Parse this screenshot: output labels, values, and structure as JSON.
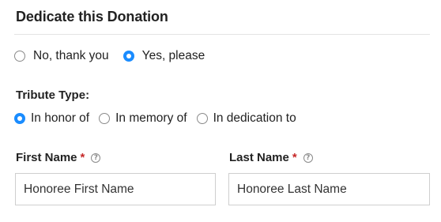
{
  "section": {
    "title": "Dedicate this Donation"
  },
  "dedicate": {
    "options": [
      {
        "label": "No, thank you",
        "checked": false
      },
      {
        "label": "Yes, please",
        "checked": true
      }
    ]
  },
  "tribute": {
    "label": "Tribute Type:",
    "options": [
      {
        "label": "In honor of",
        "checked": true
      },
      {
        "label": "In memory of",
        "checked": false
      },
      {
        "label": "In dedication to",
        "checked": false
      }
    ]
  },
  "fields": {
    "first_name": {
      "label": "First Name",
      "required_mark": "*",
      "help_icon": "?",
      "placeholder": "Honoree First Name",
      "value": ""
    },
    "last_name": {
      "label": "Last Name",
      "required_mark": "*",
      "help_icon": "?",
      "placeholder": "Honoree Last Name",
      "value": ""
    }
  },
  "colors": {
    "accent": "#1a8cff",
    "required": "#c62828",
    "border": "#cfcfcf",
    "divider": "#e3e3e3"
  }
}
